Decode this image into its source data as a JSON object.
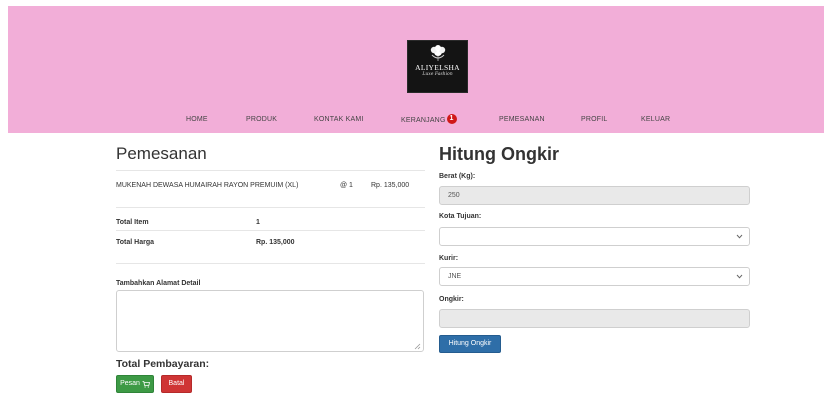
{
  "logo": {
    "brand": "ALIYELSHA",
    "tagline": "Luxe Fashion"
  },
  "nav": {
    "items": [
      {
        "label": "HOME"
      },
      {
        "label": "PRODUK"
      },
      {
        "label": "KONTAK KAMI"
      },
      {
        "label": "KERANJANG"
      },
      {
        "label": "PEMESANAN"
      },
      {
        "label": "PROFIL"
      },
      {
        "label": "KELUAR"
      }
    ],
    "cart_count": "1"
  },
  "order": {
    "title": "Pemesanan",
    "item": {
      "name": "MUKENAH DEWASA HUMAIRAH RAYON PREMUIM (XL)",
      "qty": "@ 1",
      "price": "Rp. 135,000"
    },
    "total_item_label": "Total Item",
    "total_item_value": "1",
    "total_harga_label": "Total Harga",
    "total_harga_value": "Rp. 135,000",
    "address_label": "Tambahkan Alamat Detail",
    "address_value": "",
    "total_pembayaran_label": "Total Pembayaran:",
    "pesan_button": "Pesan",
    "batal_button": "Batal"
  },
  "shipping": {
    "title": "Hitung Ongkir",
    "berat_label": "Berat (Kg):",
    "berat_value": "250",
    "kota_label": "Kota Tujuan:",
    "kota_value": "",
    "kurir_label": "Kurir:",
    "kurir_value": "JNE",
    "ongkir_label": "Ongkir:",
    "ongkir_value": "",
    "hitung_button": "Hitung Ongkir"
  },
  "colors": {
    "header_bg": "#f2aed8",
    "badge": "#d01818",
    "pesan": "#3d9a45",
    "batal": "#cf3535",
    "hitung": "#2e6ea8"
  }
}
